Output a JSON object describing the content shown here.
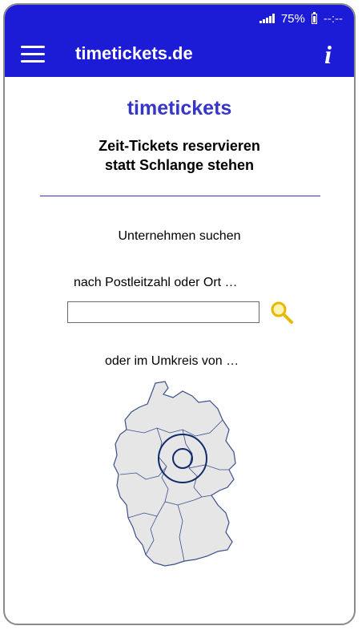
{
  "status": {
    "battery": "75%",
    "time": "--:--",
    "icons": [
      "signal-icon",
      "battery-icon"
    ]
  },
  "appbar": {
    "title": "timetickets.de",
    "menu_icon": "hamburger-menu-icon",
    "info_icon": "info-icon",
    "info_glyph": "i"
  },
  "main": {
    "brand": "timetickets",
    "tagline_line1": "Zeit-Tickets reservieren",
    "tagline_line2": "statt Schlange stehen",
    "section_title": "Unternehmen suchen",
    "plz_label": "nach Postleitzahl oder Ort …",
    "search_value": "",
    "search_icon": "magnifier-icon",
    "radius_label": "oder im Umkreis von …",
    "map_icon": "germany-map-icon"
  },
  "colors": {
    "primary": "#1c1cd6",
    "brand_text": "#3535c8",
    "search_icon": "#e6b800",
    "map_fill": "#e6e6e6",
    "map_border": "#3c4f8c",
    "circle": "#0f2a6b"
  }
}
